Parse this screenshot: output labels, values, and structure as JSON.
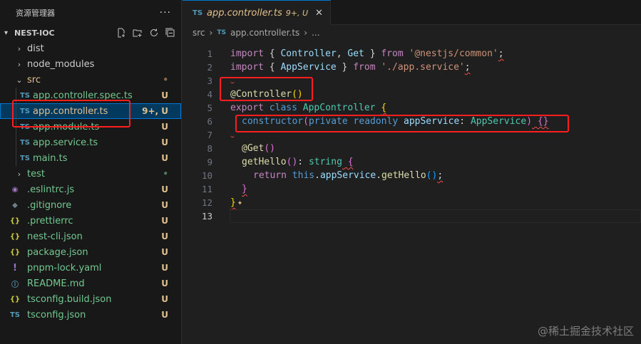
{
  "sidebar": {
    "title": "资源管理器",
    "more": "···",
    "project": "NEST-IOC",
    "items": [
      {
        "name": "dist",
        "type": "folder",
        "status": ""
      },
      {
        "name": "node_modules",
        "type": "folder",
        "status": ""
      },
      {
        "name": "src",
        "type": "folder-open",
        "status": "•"
      },
      {
        "name": "app.controller.spec.ts",
        "type": "ts",
        "status": "U"
      },
      {
        "name": "app.controller.ts",
        "type": "ts",
        "status": "9+, U"
      },
      {
        "name": "app.module.ts",
        "type": "ts",
        "status": "U"
      },
      {
        "name": "app.service.ts",
        "type": "ts",
        "status": "U"
      },
      {
        "name": "main.ts",
        "type": "ts",
        "status": "U"
      },
      {
        "name": "test",
        "type": "folder",
        "status": "•"
      },
      {
        "name": ".eslintrc.js",
        "type": "eslint",
        "status": "U"
      },
      {
        "name": ".gitignore",
        "type": "git",
        "status": "U"
      },
      {
        "name": ".prettierrc",
        "type": "json",
        "status": "U"
      },
      {
        "name": "nest-cli.json",
        "type": "json",
        "status": "U"
      },
      {
        "name": "package.json",
        "type": "json",
        "status": "U"
      },
      {
        "name": "pnpm-lock.yaml",
        "type": "yaml",
        "status": "U"
      },
      {
        "name": "README.md",
        "type": "info",
        "status": "U"
      },
      {
        "name": "tsconfig.build.json",
        "type": "json",
        "status": "U"
      },
      {
        "name": "tsconfig.json",
        "type": "ts",
        "status": "U"
      }
    ]
  },
  "icons": {
    "ts": "TS",
    "json": "{}",
    "yaml": "!",
    "info": "ⓘ",
    "eslint": "◉",
    "git": "◆"
  },
  "tab": {
    "filename": "app.controller.ts",
    "badge": "9+, U",
    "close": "✕"
  },
  "breadcrumb": {
    "folder": "src",
    "file": "app.controller.ts",
    "rest": "..."
  },
  "code": {
    "line_numbers": [
      "1",
      "2",
      "3",
      "4",
      "5",
      "6",
      "7",
      "8",
      "9",
      "10",
      "11",
      "12",
      "13"
    ],
    "l1": {
      "import": "import",
      "open": " { ",
      "a": "Controller",
      "comma": ", ",
      "b": "Get",
      "close": " } ",
      "from": "from",
      "sp": " ",
      "src": "'@nestjs/common'",
      "semi": ";"
    },
    "l2": {
      "import": "import",
      "open": " { ",
      "a": "AppService",
      "close": " } ",
      "from": "from",
      "sp": " ",
      "src": "'./app.service'",
      "semi": ";"
    },
    "l4": {
      "at": "@",
      "deco": "Controller",
      "parens": "()"
    },
    "l5": {
      "export": "export",
      "sp": " ",
      "class": "class",
      "name": " AppController ",
      "brace": "{"
    },
    "l6": {
      "ctor": "constructor",
      "open": "(",
      "priv": "private",
      "ro": " readonly ",
      "param": "appService",
      "colon": ": ",
      "type": "AppService",
      "close": ")",
      "body": " {}"
    },
    "l8": {
      "at": "@",
      "deco": "Get",
      "parens": "()"
    },
    "l9": {
      "fn": "getHello",
      "parens": "()",
      "colon": ": ",
      "type": "string",
      "brace": " {"
    },
    "l10": {
      "ret": "return",
      "sp": " ",
      "this": "this",
      "dot": ".",
      "svc": "appService",
      "dot2": ".",
      "call": "getHello",
      "parens": "()",
      "semi": ";"
    },
    "l11": {
      "brace": "}"
    },
    "l12": {
      "brace": "}",
      "sparkle": "✦"
    }
  },
  "watermark": "@稀土掘金技术社区"
}
